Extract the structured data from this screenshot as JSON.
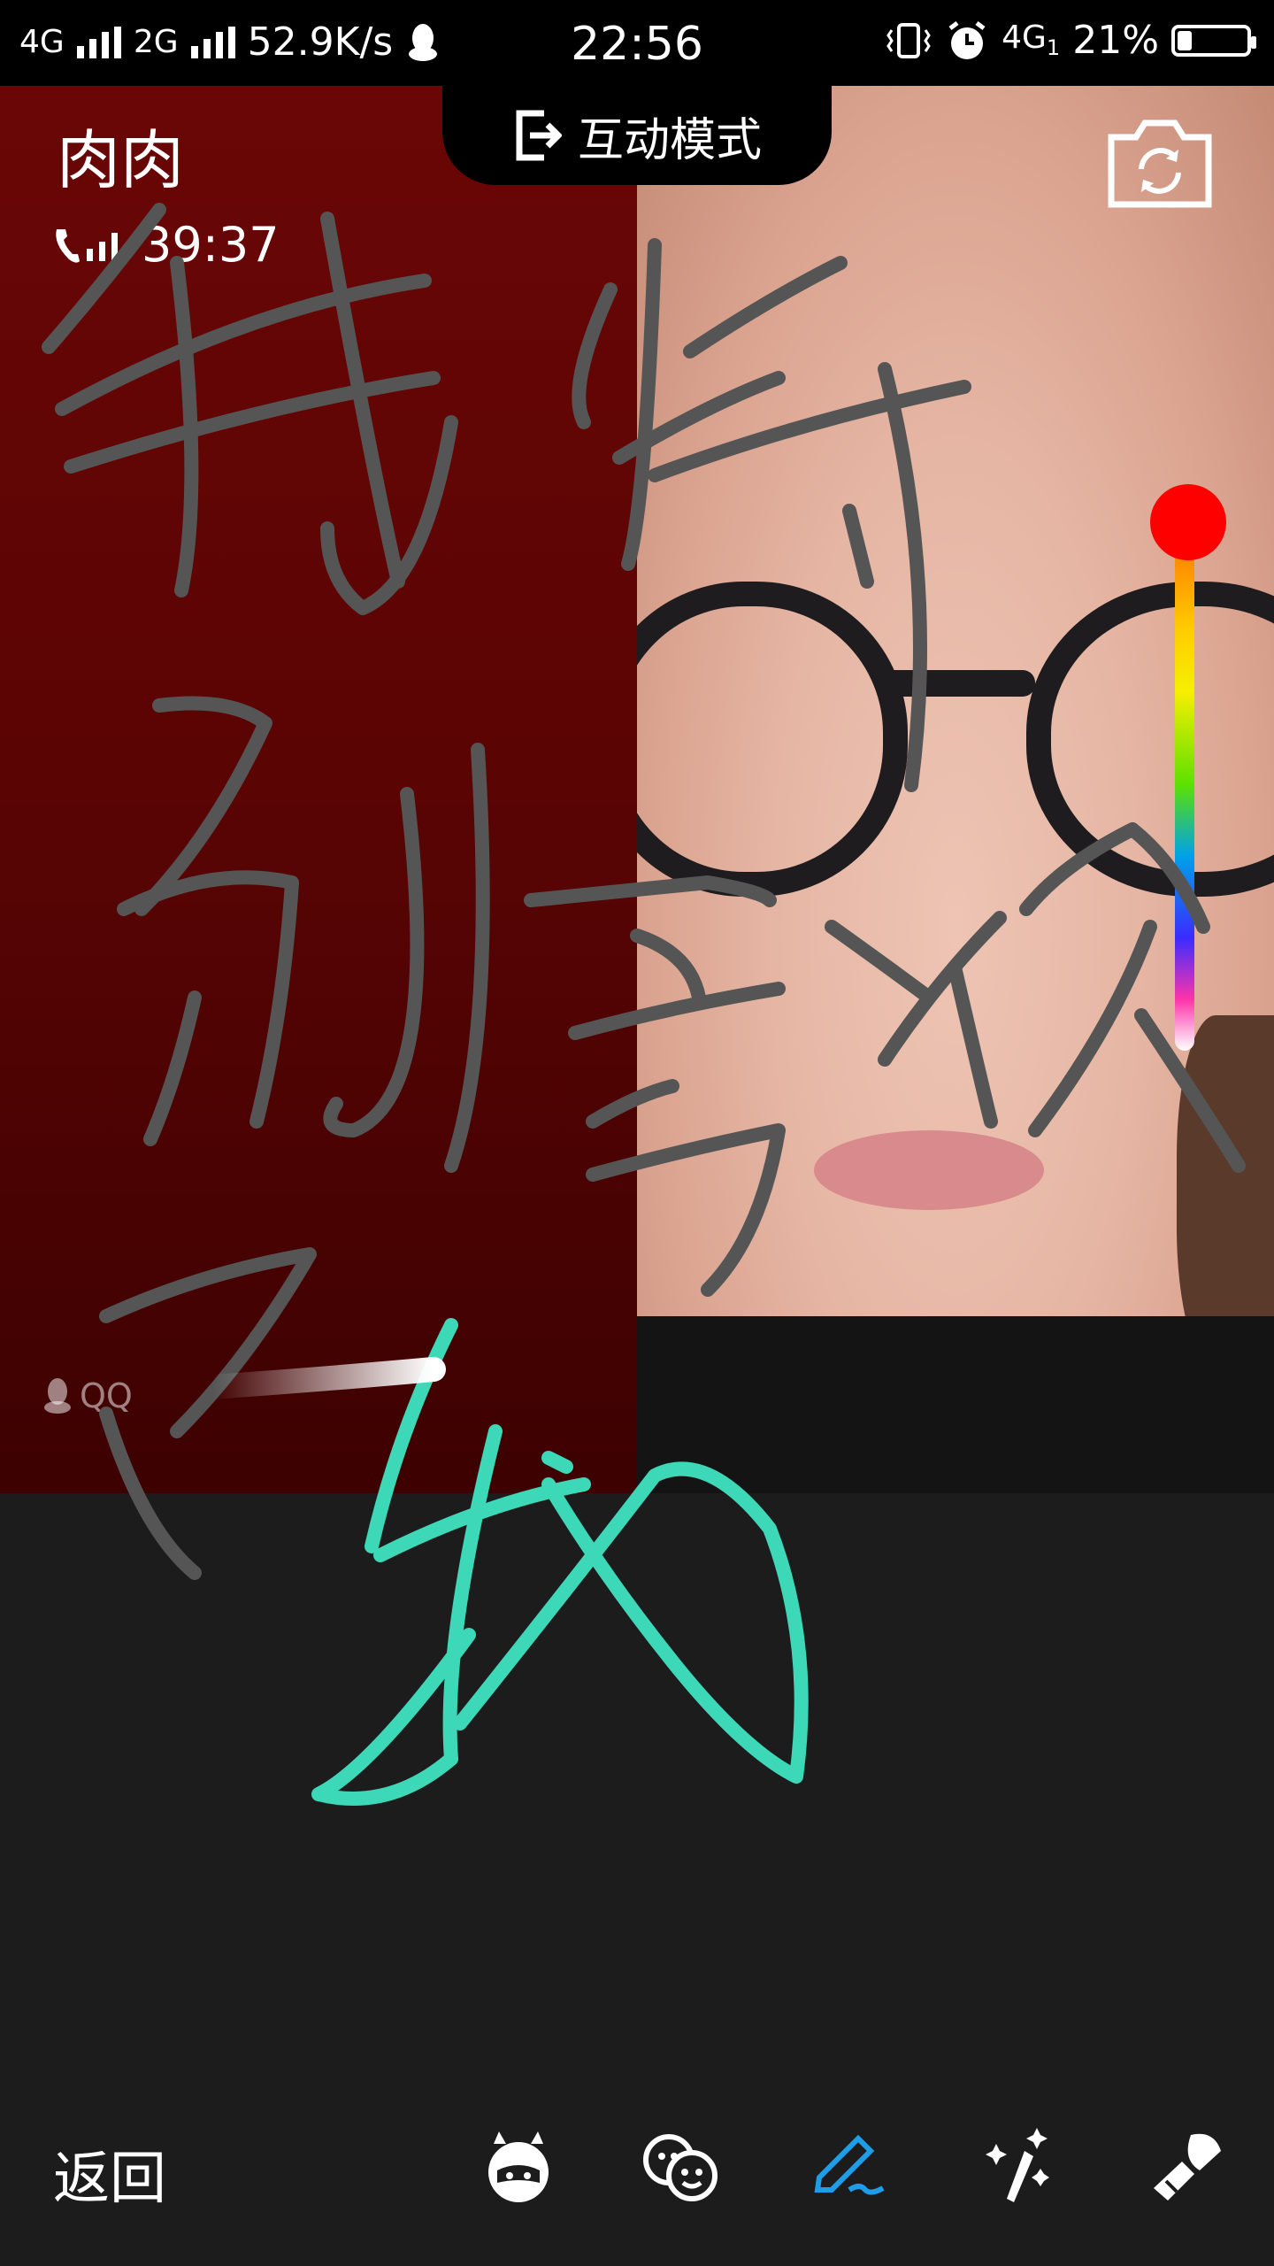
{
  "status_bar": {
    "network_1": "4G",
    "network_2": "2G",
    "speed": "52.9K/s",
    "time": "22:56",
    "network_3": "4G",
    "network_3_sub": "1",
    "battery": "21%",
    "battery_level": 0.21
  },
  "call": {
    "mode_label": "互动模式",
    "caller_name": "肉肉",
    "duration": "39:37",
    "watermark": "QQ"
  },
  "colors": {
    "selected_pen": "#ff0000",
    "stroke_gray": "#555555",
    "stroke_teal": "#3dd8b8",
    "active_tool": "#1e9ee8"
  },
  "toolbar": {
    "back_label": "返回",
    "tools": [
      "avatar-mask-icon",
      "face-sticker-icon",
      "pen-icon",
      "magic-wand-icon",
      "beauty-brush-icon"
    ],
    "active_tool": "pen-icon"
  }
}
